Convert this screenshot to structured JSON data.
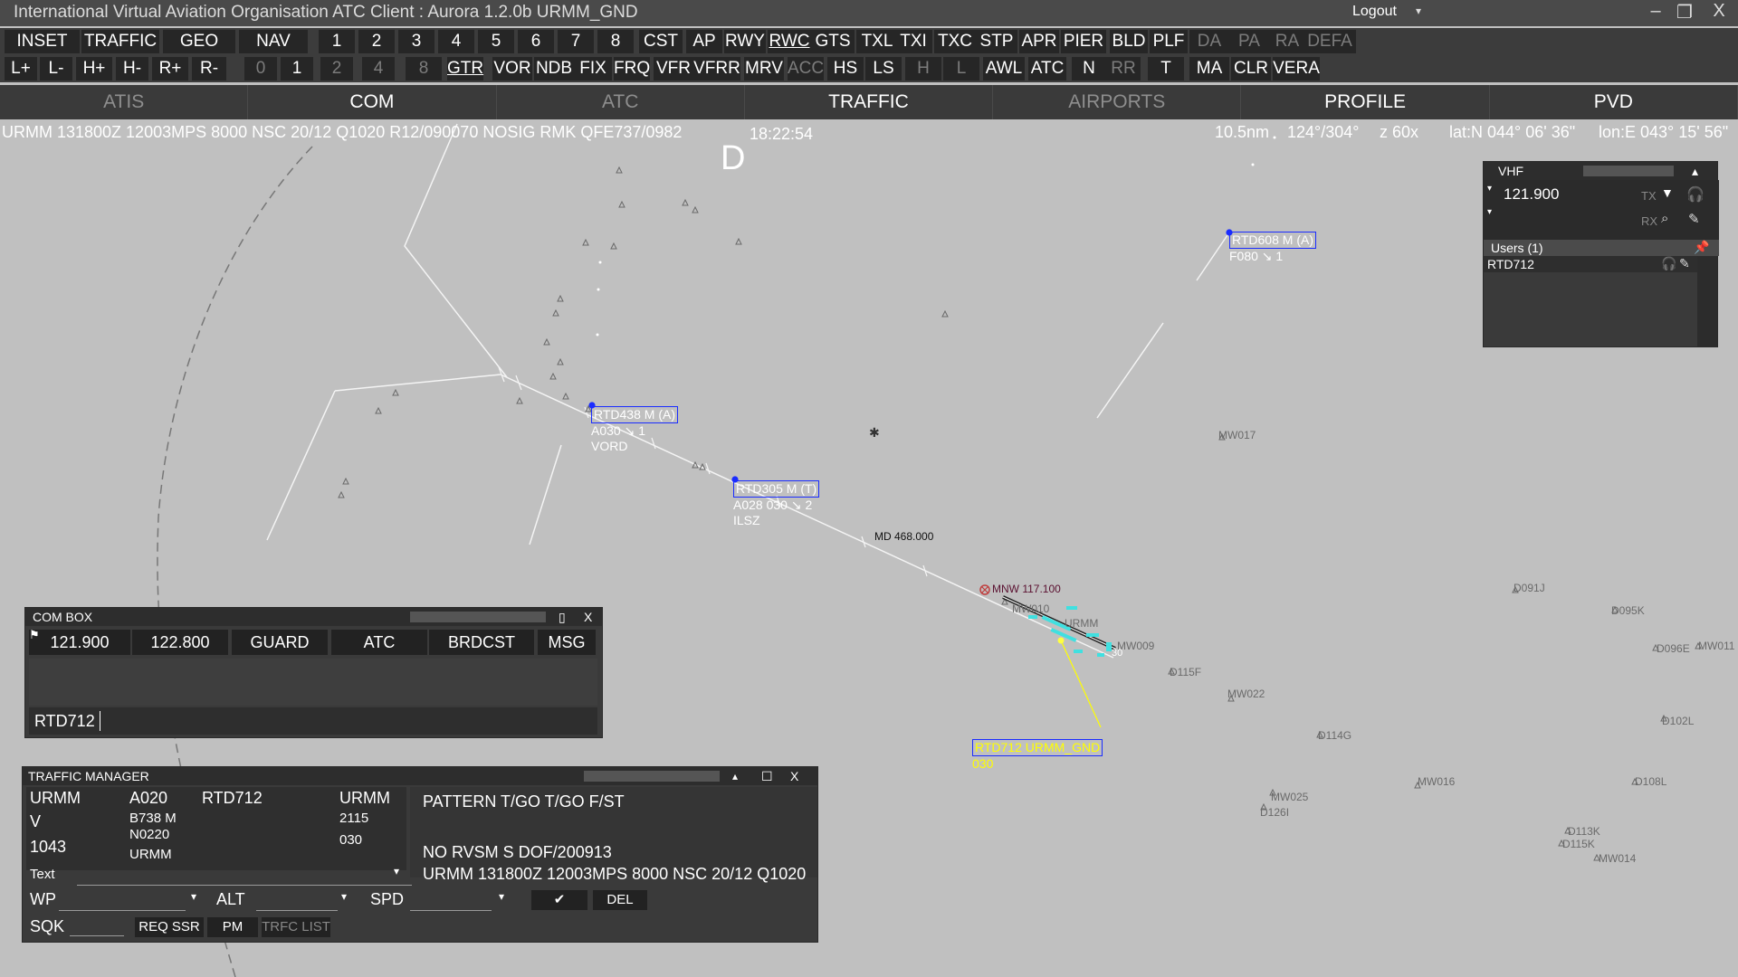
{
  "window": {
    "title": "International Virtual Aviation Organisation  ATC Client : Aurora 1.2.0b  URMM_GND",
    "logout_label": "Logout",
    "logout_caret": "▾",
    "minimize": "–",
    "restore": "❐",
    "close": "X"
  },
  "toolbar1": [
    {
      "label": "INSET",
      "dim": false
    },
    {
      "label": "TRAFFIC",
      "dim": false
    },
    {
      "label": "GEO",
      "dim": false
    },
    {
      "label": "NAV",
      "dim": false
    },
    {
      "label": "1",
      "dim": false
    },
    {
      "label": "2",
      "dim": false
    },
    {
      "label": "3",
      "dim": false
    },
    {
      "label": "4",
      "dim": false
    },
    {
      "label": "5",
      "dim": false
    },
    {
      "label": "6",
      "dim": false
    },
    {
      "label": "7",
      "dim": false
    },
    {
      "label": "8",
      "dim": false
    },
    {
      "label": "CST",
      "dim": false
    },
    {
      "label": "AP",
      "dim": false
    },
    {
      "label": "RWY",
      "dim": false
    },
    {
      "label": "RWC",
      "dim": false,
      "underline": true
    },
    {
      "label": "GTS",
      "dim": false
    },
    {
      "label": "TXL",
      "dim": false
    },
    {
      "label": "TXI",
      "dim": false
    },
    {
      "label": "TXC",
      "dim": false
    },
    {
      "label": "STP",
      "dim": false
    },
    {
      "label": "APR",
      "dim": false
    },
    {
      "label": "PIER",
      "dim": false
    },
    {
      "label": "BLD",
      "dim": false
    },
    {
      "label": "PLF",
      "dim": false
    },
    {
      "label": "DA",
      "dim": true
    },
    {
      "label": "PA",
      "dim": true
    },
    {
      "label": "RA",
      "dim": true
    },
    {
      "label": "DEFA",
      "dim": true
    }
  ],
  "toolbar2": [
    {
      "label": "L+",
      "dim": false
    },
    {
      "label": "L-",
      "dim": false
    },
    {
      "label": "H+",
      "dim": false
    },
    {
      "label": "H-",
      "dim": false
    },
    {
      "label": "R+",
      "dim": false
    },
    {
      "label": "R-",
      "dim": false
    },
    {
      "label": "0",
      "dim": true
    },
    {
      "label": "1",
      "dim": false
    },
    {
      "label": "2",
      "dim": true
    },
    {
      "label": "4",
      "dim": true
    },
    {
      "label": "8",
      "dim": true
    },
    {
      "label": "GTR",
      "dim": false,
      "underline": true
    },
    {
      "label": "VOR",
      "dim": false
    },
    {
      "label": "NDB",
      "dim": false
    },
    {
      "label": "FIX",
      "dim": false
    },
    {
      "label": "FRQ",
      "dim": false
    },
    {
      "label": "VFR",
      "dim": false
    },
    {
      "label": "VFRR",
      "dim": false
    },
    {
      "label": "MRV",
      "dim": false
    },
    {
      "label": "ACC",
      "dim": true
    },
    {
      "label": "HS",
      "dim": false
    },
    {
      "label": "LS",
      "dim": false
    },
    {
      "label": "H",
      "dim": true
    },
    {
      "label": "L",
      "dim": true
    },
    {
      "label": "AWL",
      "dim": false
    },
    {
      "label": "ATC",
      "dim": false
    },
    {
      "label": "N",
      "dim": false
    },
    {
      "label": "RR",
      "dim": true
    },
    {
      "label": "T",
      "dim": false
    },
    {
      "label": "MA",
      "dim": false
    },
    {
      "label": "CLR",
      "dim": false
    },
    {
      "label": "VERA",
      "dim": false
    }
  ],
  "tabs": [
    {
      "label": "ATIS",
      "dim": true
    },
    {
      "label": "COM",
      "dim": false
    },
    {
      "label": "ATC",
      "dim": true
    },
    {
      "label": "TRAFFIC",
      "dim": false
    },
    {
      "label": "AIRPORTS",
      "dim": true
    },
    {
      "label": "PROFILE",
      "dim": false
    },
    {
      "label": "PVD",
      "dim": false
    }
  ],
  "hud": {
    "metar": "URMM 131800Z 12003MPS 8000 NSC 20/12 Q1020 R12/090070 NOSIG RMK QFE737/0982",
    "clock": "18:22:54",
    "letter": "D",
    "range": "10.5nm",
    "bearing": "124°/304°",
    "zoom": "z 60x",
    "lat": "lat:N 044° 06' 36\"",
    "lon": "lon:E 043° 15' 56\""
  },
  "aircraft": [
    {
      "callsign": "RTD608 M (A)",
      "line2": "F080 ↘ 1",
      "line3": ""
    },
    {
      "callsign": "RTD438 M (A)",
      "line2": "A030 ↘ 1",
      "line3": "VORD"
    },
    {
      "callsign": "RTD305 M (T)",
      "line2": "A028 030 ↘ 2",
      "line3": "ILSZ"
    },
    {
      "callsign": "RTD712 URMM_GND",
      "line2": "030",
      "line3": ""
    }
  ],
  "fixes": [
    "MD 468.000",
    "MNW 117.100",
    "MW010",
    "URMM",
    "MW009",
    "30",
    "MW017",
    "D115F",
    "MW022",
    "D114G",
    "MW025",
    "D126I",
    "MW016",
    "D091J",
    "D095K",
    "D096E",
    "MW011",
    "D102L",
    "D108L",
    "D113K",
    "D115K",
    "MW014"
  ],
  "vhf": {
    "title": "VHF",
    "freq": "121.900",
    "tx": "TX",
    "rx": "RX",
    "users_header": "Users (1)",
    "users": [
      "RTD712"
    ]
  },
  "combox": {
    "title": "COM BOX",
    "restore": "▯",
    "close": "X",
    "tabs": [
      "121.900",
      "122.800",
      "GUARD",
      "ATC",
      "BRDCST",
      "MSG"
    ],
    "input_value": "RTD712"
  },
  "traffic_manager": {
    "title": "TRAFFIC MANAGER",
    "collapse": "▴",
    "restore": "☐",
    "close": "X",
    "origin": "URMM",
    "flight_rules": "V",
    "squawk_display": "1043",
    "type": "A020",
    "equipment": "B738 M",
    "speed_level": "N0220",
    "dep": "URMM",
    "callsign": "RTD712",
    "dest": "URMM",
    "eobt": "2115",
    "level": "030",
    "route": "PATTERN T/GO T/GO F/ST",
    "remarks": "NO RVSM S DOF/200913",
    "metar": "URMM 131800Z 12003MPS 8000 NSC 20/12 Q1020",
    "text_label": "Text",
    "wp_label": "WP",
    "alt_label": "ALT",
    "spd_label": "SPD",
    "sqk_label": "SQK",
    "ok_label": "✔",
    "del_label": "DEL",
    "req_ssr": "REQ SSR",
    "pm": "PM",
    "trfc_list": "TRFC LIST"
  },
  "colors": {
    "scope_bg": "#c0c0c0",
    "toolbar_bg": "#3c3c3c",
    "button_bg": "#262626",
    "aircraft_box": "#1a2cff",
    "selected_aircraft": "#ffff00",
    "ground_traffic": "#40e0e0"
  }
}
